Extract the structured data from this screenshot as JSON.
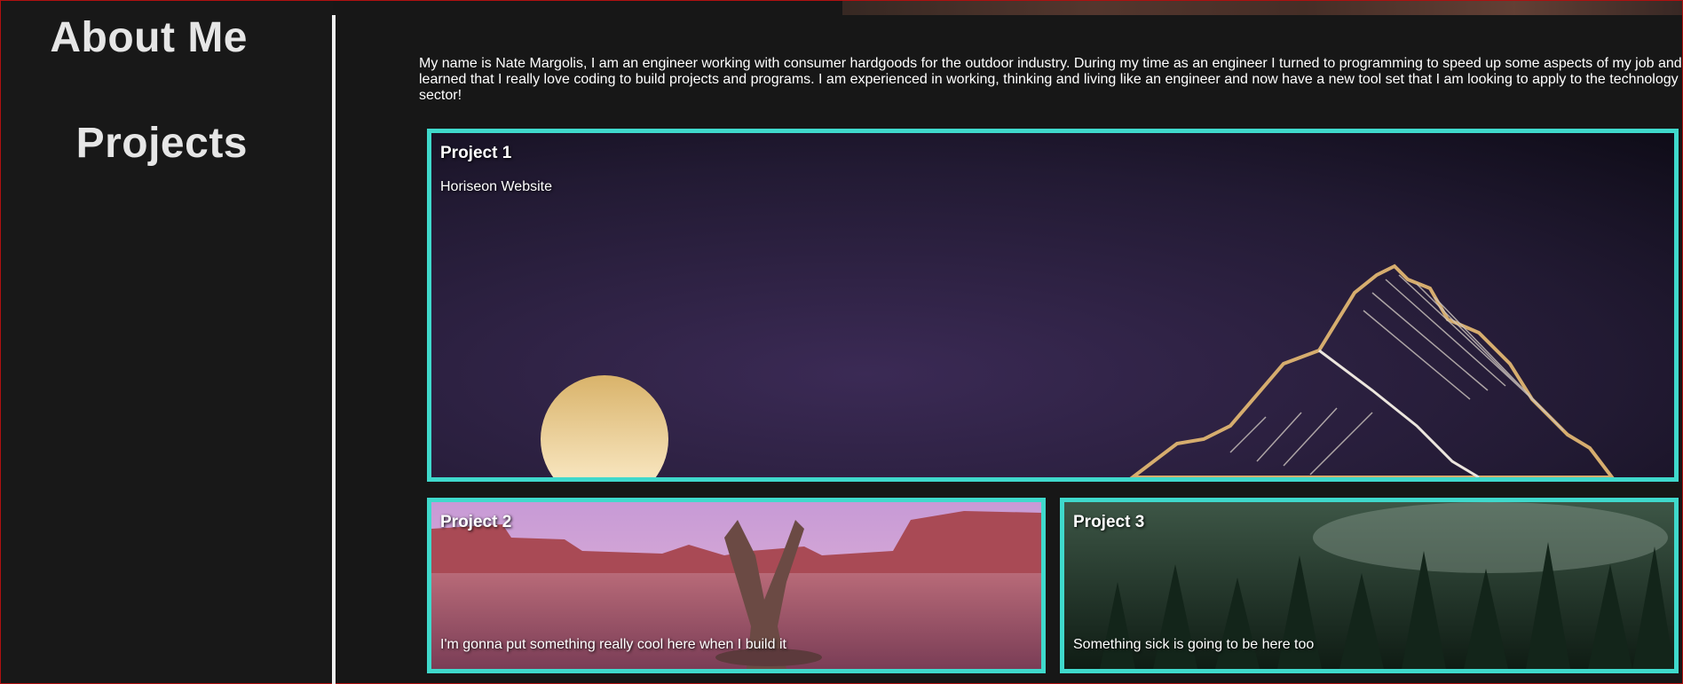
{
  "nav": {
    "about_label": "About Me",
    "projects_label": "Projects"
  },
  "about": {
    "text": "My name is Nate Margolis, I am an engineer working with consumer hardgoods for the outdoor industry. During my time as an engineer I turned to programming to speed up some aspects of my job and learned that I really love coding to build projects and programs. I am experienced in working, thinking and living like an engineer and now have a new tool set that I am looking to apply to the technology sector!"
  },
  "projects": [
    {
      "title": "Project 1",
      "description": "Horiseon Website",
      "image": "moon-mountain-night"
    },
    {
      "title": "Project 2",
      "description": "I'm gonna put something really cool here when I build it",
      "image": "desert-canyon-tree"
    },
    {
      "title": "Project 3",
      "description": "Something sick is going to be here too",
      "image": "misty-pine-forest"
    }
  ],
  "colors": {
    "background": "#171717",
    "card_border": "#3fd9cc",
    "nav_text": "#e6e6e6",
    "divider": "#f2f2f2"
  }
}
